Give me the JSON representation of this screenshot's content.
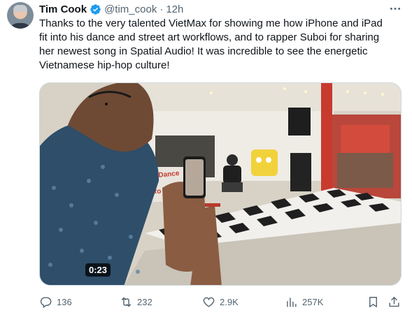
{
  "tweet": {
    "author_name": "Tim Cook",
    "handle": "@tim_cook",
    "separator": "·",
    "time": "12h",
    "text_lines": [
      "Thanks to the very talented VietMax for showing me how iPhone and iPad",
      "fit into his dance and street art workflows, and to rapper Suboi for sharing",
      "her newest song in Spatial Audio! It was incredible to see the energetic",
      "Vietnamese hip-hop culture!"
    ],
    "verified_color": "#1d9bf0",
    "media": {
      "duration": "0:23",
      "wall_sign_1": "Beb Dance",
      "wall_sign_2": "Ro"
    },
    "actions": {
      "replies": "136",
      "reposts": "232",
      "likes": "2.9K",
      "views": "257K"
    }
  },
  "icons": [
    "more-icon",
    "verified-icon",
    "reply-icon",
    "repost-icon",
    "like-icon",
    "views-icon",
    "bookmark-icon",
    "share-icon"
  ]
}
